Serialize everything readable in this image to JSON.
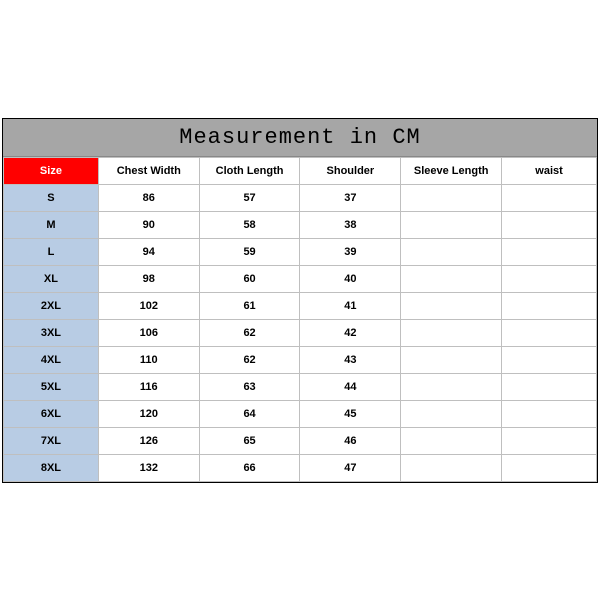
{
  "chart_data": {
    "type": "table",
    "title": "Measurement in CM",
    "columns": [
      "Size",
      "Chest Width",
      "Cloth Length",
      "Shoulder",
      "Sleeve Length",
      "waist"
    ],
    "rows": [
      {
        "size": "S",
        "chest": "86",
        "length": "57",
        "shoulder": "37",
        "sleeve": "",
        "waist": ""
      },
      {
        "size": "M",
        "chest": "90",
        "length": "58",
        "shoulder": "38",
        "sleeve": "",
        "waist": ""
      },
      {
        "size": "L",
        "chest": "94",
        "length": "59",
        "shoulder": "39",
        "sleeve": "",
        "waist": ""
      },
      {
        "size": "XL",
        "chest": "98",
        "length": "60",
        "shoulder": "40",
        "sleeve": "",
        "waist": ""
      },
      {
        "size": "2XL",
        "chest": "102",
        "length": "61",
        "shoulder": "41",
        "sleeve": "",
        "waist": ""
      },
      {
        "size": "3XL",
        "chest": "106",
        "length": "62",
        "shoulder": "42",
        "sleeve": "",
        "waist": ""
      },
      {
        "size": "4XL",
        "chest": "110",
        "length": "62",
        "shoulder": "43",
        "sleeve": "",
        "waist": ""
      },
      {
        "size": "5XL",
        "chest": "116",
        "length": "63",
        "shoulder": "44",
        "sleeve": "",
        "waist": ""
      },
      {
        "size": "6XL",
        "chest": "120",
        "length": "64",
        "shoulder": "45",
        "sleeve": "",
        "waist": ""
      },
      {
        "size": "7XL",
        "chest": "126",
        "length": "65",
        "shoulder": "46",
        "sleeve": "",
        "waist": ""
      },
      {
        "size": "8XL",
        "chest": "132",
        "length": "66",
        "shoulder": "47",
        "sleeve": "",
        "waist": ""
      }
    ]
  }
}
